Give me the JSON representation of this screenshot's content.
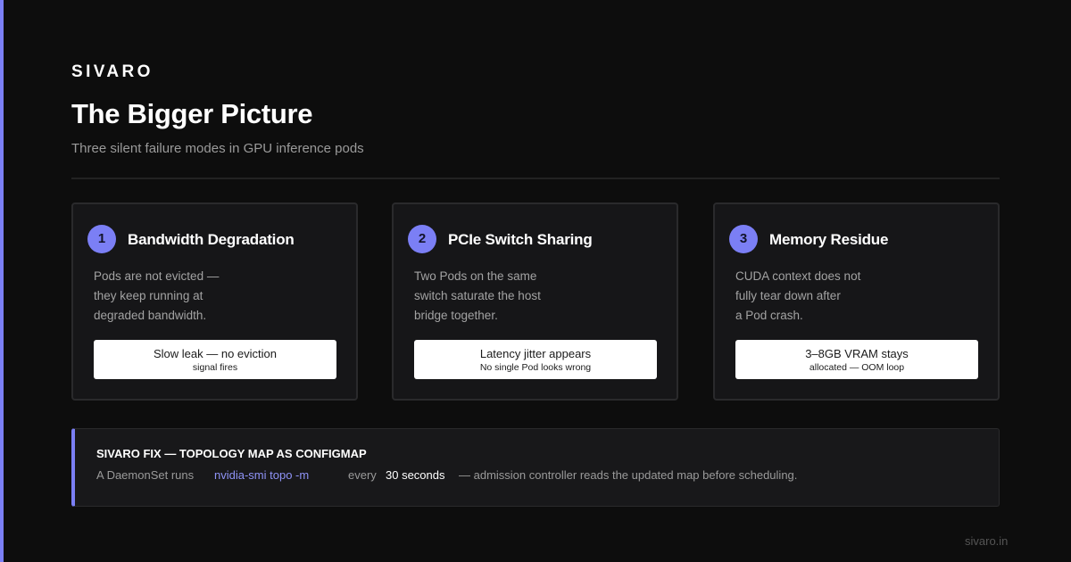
{
  "brand": "SIVARO",
  "title": "The Bigger Picture",
  "subtitle": "Three silent failure modes in GPU inference pods",
  "accent_color": "#7b7ff5",
  "cards": [
    {
      "number": "1",
      "title": "Bandwidth Degradation",
      "desc_lines": [
        "Pods are not evicted —",
        "they keep running at",
        "degraded bandwidth."
      ],
      "pill_main": "Slow leak — no eviction",
      "pill_sub": "signal fires"
    },
    {
      "number": "2",
      "title": "PCIe Switch Sharing",
      "desc_lines": [
        "Two Pods on the same",
        "switch saturate the host",
        "bridge together."
      ],
      "pill_main": "Latency jitter appears",
      "pill_sub": "No single Pod looks wrong"
    },
    {
      "number": "3",
      "title": "Memory Residue",
      "desc_lines": [
        "CUDA context does not",
        "fully tear down after",
        "a Pod crash."
      ],
      "pill_main": "3–8GB VRAM stays",
      "pill_sub": "allocated — OOM loop"
    }
  ],
  "fix": {
    "title": "SIVARO FIX — TOPOLOGY MAP AS CONFIGMAP",
    "text_1": "A DaemonSet runs",
    "command": "nvidia-smi topo -m",
    "text_2": "every",
    "interval": "30 seconds",
    "text_3": "— admission controller reads the updated map before scheduling."
  },
  "footer_url": "sivaro.in"
}
